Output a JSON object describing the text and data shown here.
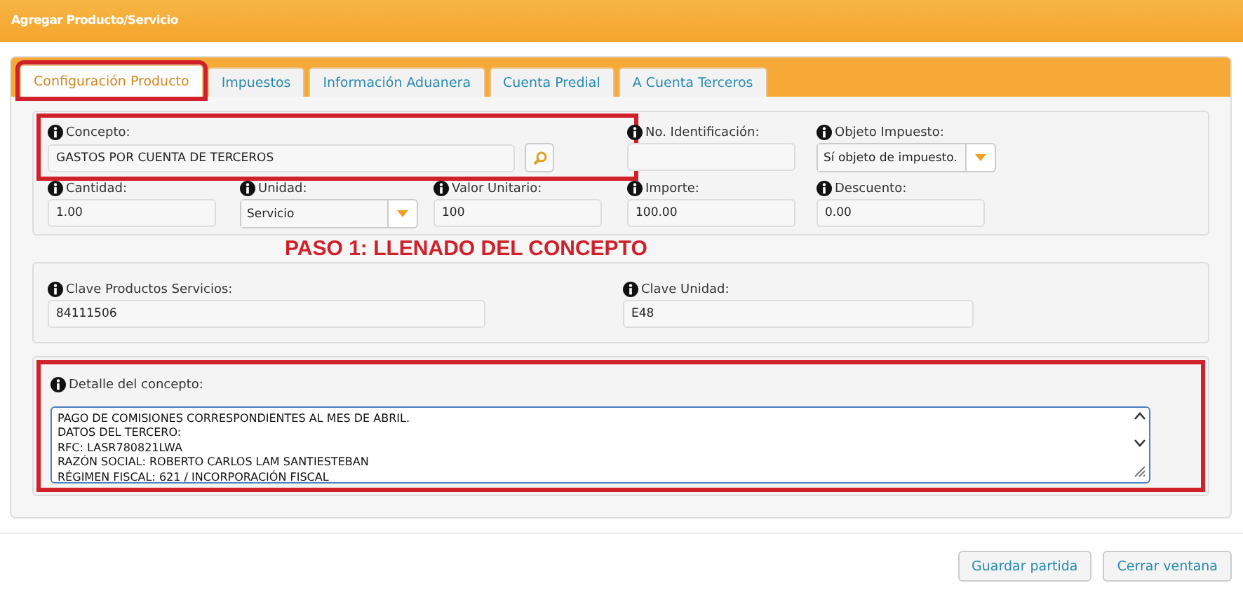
{
  "window": {
    "title": "Agregar Producto/Servicio"
  },
  "tabs": [
    {
      "label": "Configuración Producto",
      "selected": true,
      "highlighted": true
    },
    {
      "label": "Impuestos",
      "selected": false,
      "highlighted": false
    },
    {
      "label": "Información Aduanera",
      "selected": false,
      "highlighted": false
    },
    {
      "label": "Cuenta Predial",
      "selected": false,
      "highlighted": false
    },
    {
      "label": "A Cuenta Terceros",
      "selected": false,
      "highlighted": false
    }
  ],
  "section_1": {
    "row_1": [
      {
        "kind": "search",
        "label": "Concepto:",
        "value": "GASTOS POR CUENTA DE TERCEROS",
        "highlighted": true
      },
      {
        "kind": "text",
        "label": "No. Identificación:"
      },
      {
        "kind": "select",
        "label": "Objeto Impuesto:",
        "value": "Sí objeto de impuesto."
      }
    ],
    "row_2": [
      {
        "kind": "text",
        "label": "Cantidad:",
        "value": "1.00"
      },
      {
        "kind": "select",
        "label": "Unidad:",
        "value": "Servicio"
      },
      {
        "kind": "text",
        "label": "Valor Unitario:",
        "value": "100"
      },
      {
        "kind": "text",
        "label": "Importe:",
        "value": "100.00"
      },
      {
        "kind": "text",
        "label": "Descuento:",
        "value": "0.00"
      }
    ]
  },
  "annotation": "PASO 1: LLENADO DEL CONCEPTO",
  "section_2": [
    {
      "label": "Clave Productos Servicios:",
      "value": "84111506"
    },
    {
      "label": "Clave Unidad:",
      "value": "E48"
    }
  ],
  "section_3": {
    "label": "Detalle del concepto:",
    "highlighted": true,
    "lines": [
      "PAGO DE COMISIONES CORRESPONDIENTES AL MES DE ABRIL.",
      "DATOS DEL TERCERO:",
      "RFC: LASR780821LWA",
      "RAZÓN SOCIAL: ROBERTO CARLOS LAM SANTIESTEBAN",
      "RÉGIMEN FISCAL: 621 / INCORPORACIÓN FISCAL"
    ]
  },
  "buttons": [
    "Guardar partida",
    "Cerrar ventana"
  ]
}
